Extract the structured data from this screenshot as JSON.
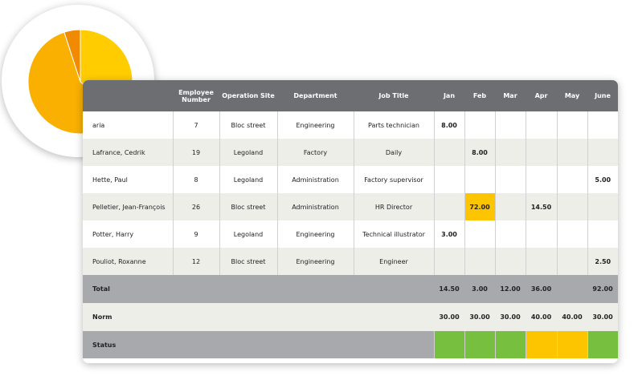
{
  "colors": {
    "header_bg": "#6d6e72",
    "highlight": "#fdc400",
    "status_ok": "#77bf3f",
    "status_warn": "#fdc400",
    "pie": [
      "#ffcc00",
      "#f9b000",
      "#f08a00"
    ]
  },
  "table": {
    "headers": {
      "name": "",
      "employee_number": "Employee Number",
      "operation_site": "Operation Site",
      "department": "Department",
      "job_title": "Job Title",
      "months": [
        "Jan",
        "Feb",
        "Mar",
        "Apr",
        "May",
        "June"
      ]
    },
    "rows": [
      {
        "name": "aria",
        "number": "7",
        "site": "Bloc street",
        "department": "Engineering",
        "job_title": "Parts technician",
        "months": [
          "8.00",
          "",
          "",
          "",
          "",
          ""
        ]
      },
      {
        "name": "Lafrance, Cedrik",
        "number": "19",
        "site": "Legoland",
        "department": "Factory",
        "job_title": "Daily",
        "months": [
          "",
          "8.00",
          "",
          "",
          "",
          ""
        ]
      },
      {
        "name": "Hette, Paul",
        "number": "8",
        "site": "Legoland",
        "department": "Administration",
        "job_title": "Factory supervisor",
        "months": [
          "",
          "",
          "",
          "",
          "",
          "5.00"
        ]
      },
      {
        "name": "Pelletier, Jean-François",
        "number": "26",
        "site": "Bloc street",
        "department": "Administration",
        "job_title": "HR Director",
        "months": [
          "",
          "72.00",
          "",
          "14.50",
          "",
          ""
        ]
      },
      {
        "name": "Potter, Harry",
        "number": "9",
        "site": "Legoland",
        "department": "Engineering",
        "job_title": "Technical illustrator",
        "months": [
          "3.00",
          "",
          "",
          "",
          "",
          ""
        ]
      },
      {
        "name": "Pouliot, Roxanne",
        "number": "12",
        "site": "Bloc street",
        "department": "Engineering",
        "job_title": "Engineer",
        "months": [
          "",
          "",
          "",
          "",
          "",
          "2.50"
        ]
      }
    ],
    "total": {
      "label": "Total",
      "months": [
        "14.50",
        "3.00",
        "12.00",
        "36.00",
        "",
        "92.00"
      ]
    },
    "norm": {
      "label": "Norm",
      "months": [
        "30.00",
        "30.00",
        "30.00",
        "40.00",
        "40.00",
        "30.00"
      ]
    },
    "status": {
      "label": "Status",
      "months": [
        "ok",
        "ok",
        "ok",
        "warn",
        "warn",
        "ok"
      ]
    }
  },
  "pie_chart": {
    "type": "pie",
    "slices": [
      0.36,
      0.59,
      0.05
    ]
  }
}
